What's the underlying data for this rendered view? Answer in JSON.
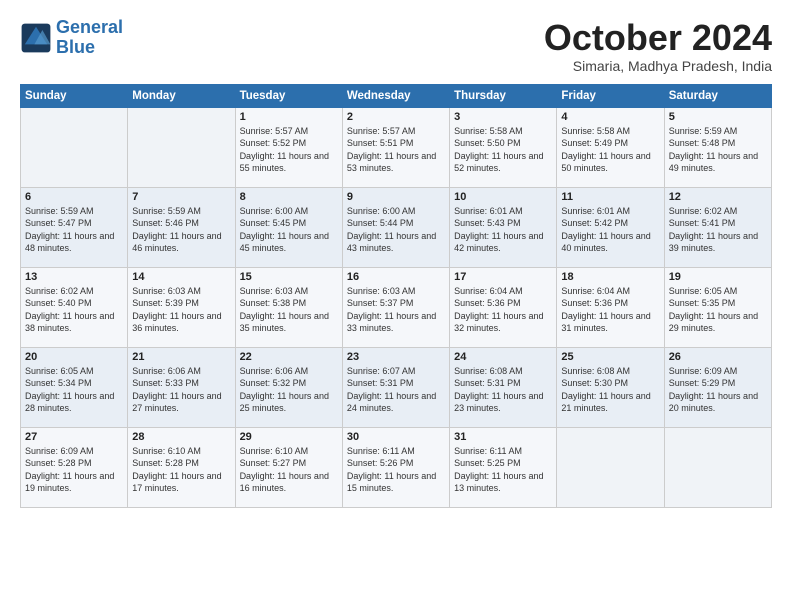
{
  "logo": {
    "line1": "General",
    "line2": "Blue"
  },
  "title": "October 2024",
  "location": "Simaria, Madhya Pradesh, India",
  "days_header": [
    "Sunday",
    "Monday",
    "Tuesday",
    "Wednesday",
    "Thursday",
    "Friday",
    "Saturday"
  ],
  "weeks": [
    [
      {
        "num": "",
        "info": ""
      },
      {
        "num": "",
        "info": ""
      },
      {
        "num": "1",
        "info": "Sunrise: 5:57 AM\nSunset: 5:52 PM\nDaylight: 11 hours and 55 minutes."
      },
      {
        "num": "2",
        "info": "Sunrise: 5:57 AM\nSunset: 5:51 PM\nDaylight: 11 hours and 53 minutes."
      },
      {
        "num": "3",
        "info": "Sunrise: 5:58 AM\nSunset: 5:50 PM\nDaylight: 11 hours and 52 minutes."
      },
      {
        "num": "4",
        "info": "Sunrise: 5:58 AM\nSunset: 5:49 PM\nDaylight: 11 hours and 50 minutes."
      },
      {
        "num": "5",
        "info": "Sunrise: 5:59 AM\nSunset: 5:48 PM\nDaylight: 11 hours and 49 minutes."
      }
    ],
    [
      {
        "num": "6",
        "info": "Sunrise: 5:59 AM\nSunset: 5:47 PM\nDaylight: 11 hours and 48 minutes."
      },
      {
        "num": "7",
        "info": "Sunrise: 5:59 AM\nSunset: 5:46 PM\nDaylight: 11 hours and 46 minutes."
      },
      {
        "num": "8",
        "info": "Sunrise: 6:00 AM\nSunset: 5:45 PM\nDaylight: 11 hours and 45 minutes."
      },
      {
        "num": "9",
        "info": "Sunrise: 6:00 AM\nSunset: 5:44 PM\nDaylight: 11 hours and 43 minutes."
      },
      {
        "num": "10",
        "info": "Sunrise: 6:01 AM\nSunset: 5:43 PM\nDaylight: 11 hours and 42 minutes."
      },
      {
        "num": "11",
        "info": "Sunrise: 6:01 AM\nSunset: 5:42 PM\nDaylight: 11 hours and 40 minutes."
      },
      {
        "num": "12",
        "info": "Sunrise: 6:02 AM\nSunset: 5:41 PM\nDaylight: 11 hours and 39 minutes."
      }
    ],
    [
      {
        "num": "13",
        "info": "Sunrise: 6:02 AM\nSunset: 5:40 PM\nDaylight: 11 hours and 38 minutes."
      },
      {
        "num": "14",
        "info": "Sunrise: 6:03 AM\nSunset: 5:39 PM\nDaylight: 11 hours and 36 minutes."
      },
      {
        "num": "15",
        "info": "Sunrise: 6:03 AM\nSunset: 5:38 PM\nDaylight: 11 hours and 35 minutes."
      },
      {
        "num": "16",
        "info": "Sunrise: 6:03 AM\nSunset: 5:37 PM\nDaylight: 11 hours and 33 minutes."
      },
      {
        "num": "17",
        "info": "Sunrise: 6:04 AM\nSunset: 5:36 PM\nDaylight: 11 hours and 32 minutes."
      },
      {
        "num": "18",
        "info": "Sunrise: 6:04 AM\nSunset: 5:36 PM\nDaylight: 11 hours and 31 minutes."
      },
      {
        "num": "19",
        "info": "Sunrise: 6:05 AM\nSunset: 5:35 PM\nDaylight: 11 hours and 29 minutes."
      }
    ],
    [
      {
        "num": "20",
        "info": "Sunrise: 6:05 AM\nSunset: 5:34 PM\nDaylight: 11 hours and 28 minutes."
      },
      {
        "num": "21",
        "info": "Sunrise: 6:06 AM\nSunset: 5:33 PM\nDaylight: 11 hours and 27 minutes."
      },
      {
        "num": "22",
        "info": "Sunrise: 6:06 AM\nSunset: 5:32 PM\nDaylight: 11 hours and 25 minutes."
      },
      {
        "num": "23",
        "info": "Sunrise: 6:07 AM\nSunset: 5:31 PM\nDaylight: 11 hours and 24 minutes."
      },
      {
        "num": "24",
        "info": "Sunrise: 6:08 AM\nSunset: 5:31 PM\nDaylight: 11 hours and 23 minutes."
      },
      {
        "num": "25",
        "info": "Sunrise: 6:08 AM\nSunset: 5:30 PM\nDaylight: 11 hours and 21 minutes."
      },
      {
        "num": "26",
        "info": "Sunrise: 6:09 AM\nSunset: 5:29 PM\nDaylight: 11 hours and 20 minutes."
      }
    ],
    [
      {
        "num": "27",
        "info": "Sunrise: 6:09 AM\nSunset: 5:28 PM\nDaylight: 11 hours and 19 minutes."
      },
      {
        "num": "28",
        "info": "Sunrise: 6:10 AM\nSunset: 5:28 PM\nDaylight: 11 hours and 17 minutes."
      },
      {
        "num": "29",
        "info": "Sunrise: 6:10 AM\nSunset: 5:27 PM\nDaylight: 11 hours and 16 minutes."
      },
      {
        "num": "30",
        "info": "Sunrise: 6:11 AM\nSunset: 5:26 PM\nDaylight: 11 hours and 15 minutes."
      },
      {
        "num": "31",
        "info": "Sunrise: 6:11 AM\nSunset: 5:25 PM\nDaylight: 11 hours and 13 minutes."
      },
      {
        "num": "",
        "info": ""
      },
      {
        "num": "",
        "info": ""
      }
    ]
  ]
}
